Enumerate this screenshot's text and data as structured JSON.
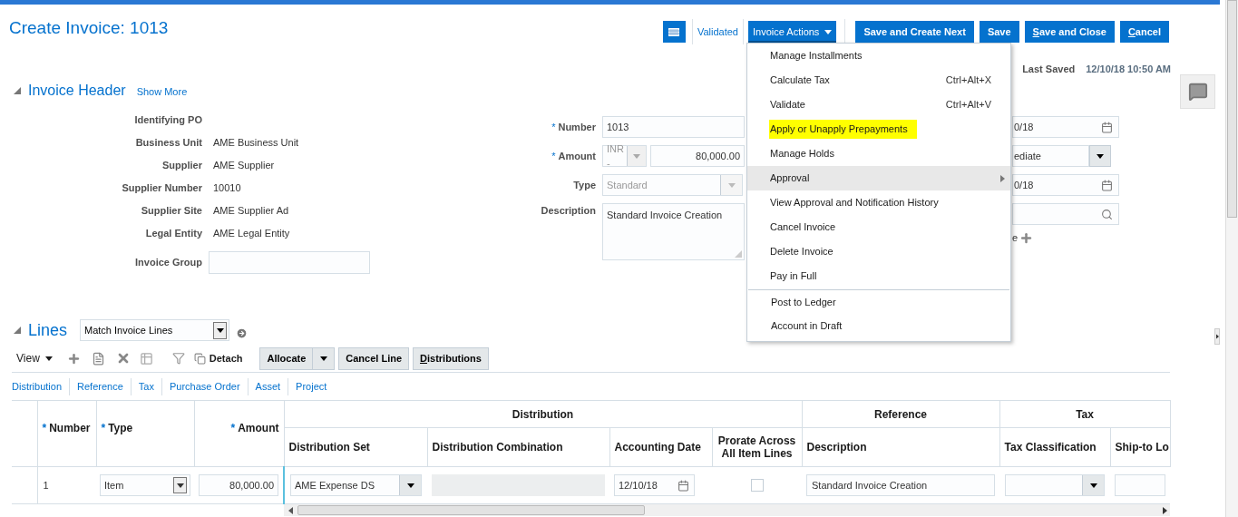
{
  "title": "Create Invoice: 1013",
  "toolbar": {
    "status_link": "Validated",
    "actions_button": {
      "label": "Invoice Actions",
      "expanded": true
    },
    "buttons": [
      {
        "label": "Save and Create Next",
        "mnemonic": false
      },
      {
        "label": "Save",
        "mnemonic": false
      },
      {
        "label": "Save and Close",
        "mnemonic": true
      },
      {
        "label": "Cancel",
        "mnemonic": true
      }
    ]
  },
  "actions_menu": {
    "groups": [
      [
        {
          "label": "Manage Installments",
          "selected": false,
          "highlighted": false,
          "submenu": false
        },
        {
          "label": "Calculate Tax",
          "shortcut": "Ctrl+Alt+X",
          "selected": false,
          "highlighted": false,
          "submenu": false
        },
        {
          "label": "Validate",
          "shortcut": "Ctrl+Alt+V",
          "selected": false,
          "highlighted": false,
          "submenu": false
        },
        {
          "label": "Apply or Unapply Prepayments",
          "selected": false,
          "highlighted": true,
          "submenu": false
        },
        {
          "label": "Manage Holds",
          "selected": false,
          "highlighted": false,
          "submenu": false
        },
        {
          "label": "Approval",
          "selected": true,
          "highlighted": false,
          "submenu": true
        },
        {
          "label": "View Approval and Notification History",
          "selected": false,
          "highlighted": false,
          "submenu": false
        },
        {
          "label": "Cancel Invoice",
          "selected": false,
          "highlighted": false,
          "submenu": false
        },
        {
          "label": "Delete Invoice",
          "selected": false,
          "highlighted": false,
          "submenu": false
        },
        {
          "label": "Pay in Full",
          "selected": false,
          "highlighted": false,
          "submenu": false
        }
      ],
      [
        {
          "label": "Post to Ledger",
          "selected": false,
          "highlighted": false,
          "submenu": false
        },
        {
          "label": "Account in Draft",
          "selected": false,
          "highlighted": false,
          "submenu": false
        }
      ]
    ]
  },
  "last_saved": {
    "label": "Last Saved",
    "value": "12/10/18 10:50 AM"
  },
  "invoice_header": {
    "title": "Invoice Header",
    "expanded": true,
    "show_more": "Show More",
    "summary": [
      {
        "label": "Identifying PO"
      },
      {
        "label": "Business Unit",
        "value": "AME Business Unit"
      },
      {
        "label": "Supplier",
        "value": "AME Supplier"
      },
      {
        "label": "Supplier Number",
        "value": "10010"
      },
      {
        "label": "Supplier Site",
        "value": "AME Supplier Ad"
      },
      {
        "label": "Legal Entity",
        "value": "AME Legal Entity"
      }
    ],
    "invoice_group": {
      "label": "Invoice Group"
    },
    "fields": [
      {
        "kind": "text",
        "label": "Number",
        "required_mark": "*",
        "value": "1013"
      },
      {
        "kind": "amount",
        "label": "Amount",
        "required_mark": "*",
        "currency": "INR -",
        "value": "80,000.00"
      },
      {
        "kind": "select",
        "label": "Type",
        "value": "Standard",
        "disabled": true
      },
      {
        "kind": "textarea",
        "label": "Description",
        "value": "Standard Invoice Creation"
      }
    ],
    "partly_hidden": [
      {
        "kind": "date",
        "value": "0/18"
      },
      {
        "kind": "select",
        "value": "ediate"
      },
      {
        "kind": "date",
        "value": "0/18"
      },
      {
        "kind": "search"
      },
      {
        "kind": "add",
        "value": "e"
      }
    ]
  },
  "lines": {
    "title": "Lines",
    "expanded": true,
    "match_select": "Match Invoice Lines",
    "view_menu": "View",
    "detach": "Detach",
    "allocate": "Allocate",
    "cancel_line": "Cancel Line",
    "distributions": "Distributions",
    "tabs": [
      "Distribution",
      "Reference",
      "Tax",
      "Purchase Order",
      "Asset",
      "Project"
    ],
    "table": {
      "header": [
        {
          "kind": "column",
          "label": "Number",
          "required_mark": "*"
        },
        {
          "kind": "column",
          "label": "Type",
          "required_mark": "*"
        },
        {
          "kind": "column",
          "label": "Amount",
          "required_mark": "*"
        },
        {
          "kind": "group",
          "label": "Distribution",
          "columns": [
            "Distribution Set",
            "Distribution Combination",
            "Accounting Date",
            "Prorate Across All Item Lines"
          ]
        },
        {
          "kind": "group",
          "label": "Reference",
          "columns": [
            "Description"
          ]
        },
        {
          "kind": "group",
          "label": "Tax",
          "columns": [
            "Tax Classification",
            "Ship-to Lo"
          ]
        }
      ],
      "rows": [
        {
          "cells": [
            {
              "kind": "text",
              "value": "1"
            },
            {
              "kind": "select",
              "value": "Item"
            },
            {
              "kind": "number",
              "value": "80,000.00"
            },
            {
              "kind": "combobox",
              "value": "AME Expense DS"
            },
            {
              "kind": "readonly"
            },
            {
              "kind": "date",
              "value": "12/10/18"
            },
            {
              "kind": "checkbox",
              "checked": false
            },
            {
              "kind": "field",
              "value": "Standard Invoice Creation"
            },
            {
              "kind": "combobox"
            },
            {
              "kind": "field"
            }
          ]
        }
      ]
    }
  }
}
